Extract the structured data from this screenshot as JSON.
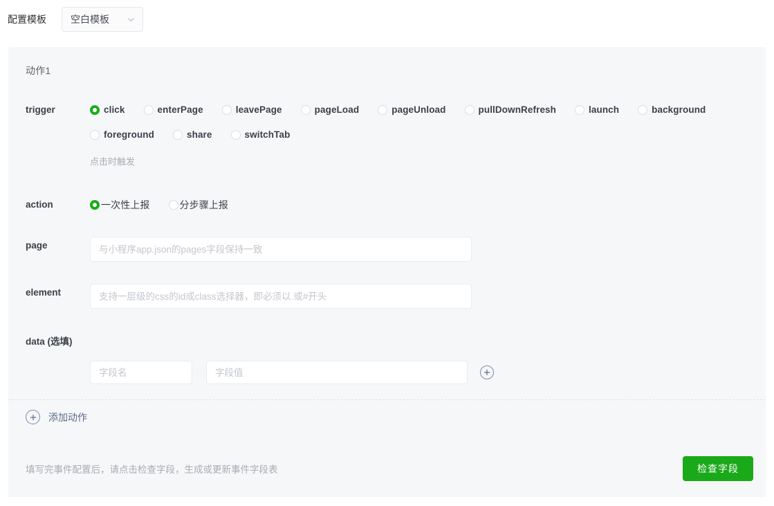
{
  "header": {
    "template_label": "配置模板",
    "template_select": {
      "value": "空白模板",
      "icon": "chevron-down-icon"
    }
  },
  "panel": {
    "action_title": "动作1",
    "trigger": {
      "label": "trigger",
      "options": [
        {
          "value": "click",
          "label": "click",
          "checked": true
        },
        {
          "value": "enterPage",
          "label": "enterPage",
          "checked": false
        },
        {
          "value": "leavePage",
          "label": "leavePage",
          "checked": false
        },
        {
          "value": "pageLoad",
          "label": "pageLoad",
          "checked": false
        },
        {
          "value": "pageUnload",
          "label": "pageUnload",
          "checked": false
        },
        {
          "value": "pullDownRefresh",
          "label": "pullDownRefresh",
          "checked": false
        },
        {
          "value": "launch",
          "label": "launch",
          "checked": false
        },
        {
          "value": "background",
          "label": "background",
          "checked": false
        },
        {
          "value": "foreground",
          "label": "foreground",
          "checked": false
        },
        {
          "value": "share",
          "label": "share",
          "checked": false
        },
        {
          "value": "switchTab",
          "label": "switchTab",
          "checked": false
        }
      ],
      "hint": "点击时触发"
    },
    "action": {
      "label": "action",
      "options": [
        {
          "value": "once",
          "label": "一次性上报",
          "checked": true
        },
        {
          "value": "stepwise",
          "label": "分步骤上报",
          "checked": false
        }
      ]
    },
    "page": {
      "label": "page",
      "value": "",
      "placeholder": "与小程序app.json的pages字段保持一致"
    },
    "element": {
      "label": "element",
      "value": "",
      "placeholder": "支持一层级的css的id或class选择器，即必须以.或#开头"
    },
    "data": {
      "title": "data (选填)",
      "key_value": "",
      "key_placeholder": "字段名",
      "val_value": "",
      "val_placeholder": "字段值",
      "add_icon": "plus-circle-icon"
    },
    "add_action": {
      "label": "添加动作",
      "icon": "plus-circle-icon"
    },
    "footer": {
      "note": "填写完事件配置后，请点击检查字段，生成或更新事件字段表",
      "submit_label": "检查字段"
    }
  },
  "colors": {
    "accent_green": "#1aaa19",
    "link_blue_gray": "#5b6b8c",
    "panel_bg": "#f6f7f9"
  }
}
